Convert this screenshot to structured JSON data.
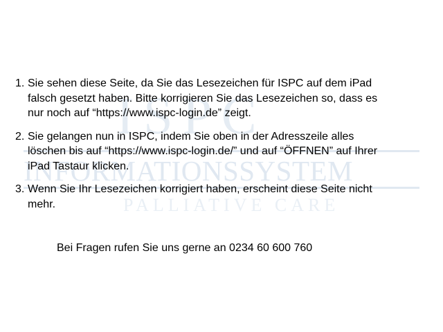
{
  "watermark": {
    "logo_top": "ISPC",
    "logo_middle": "INFORMATIONSSYSTEM",
    "logo_bottom": "PALLIATIVE CARE"
  },
  "instructions": [
    {
      "number": "1.",
      "text": "Sie sehen diese Seite, da Sie das Lesezeichen für ISPC auf dem iPad\nfalsch gesetzt haben. Bitte korrigieren Sie das Lesezeichen so, dass es\nnur noch auf “https://www.ispc-login.de” zeigt."
    },
    {
      "number": "2.",
      "text": "Sie gelangen nun in ISPC, indem Sie oben in der Adresszeile alles\nlöschen bis auf “https://www.ispc-login.de/” und auf “ÖFFNEN” auf Ihrer\niPad Tastaur klicken."
    },
    {
      "number": "3.",
      "text": "Wenn Sie Ihr Lesezeichen korrigiert haben, erscheint diese Seite nicht\nmehr."
    }
  ],
  "contact_note": "Bei Fragen rufen Sie uns gerne an 0234 60 600 760"
}
